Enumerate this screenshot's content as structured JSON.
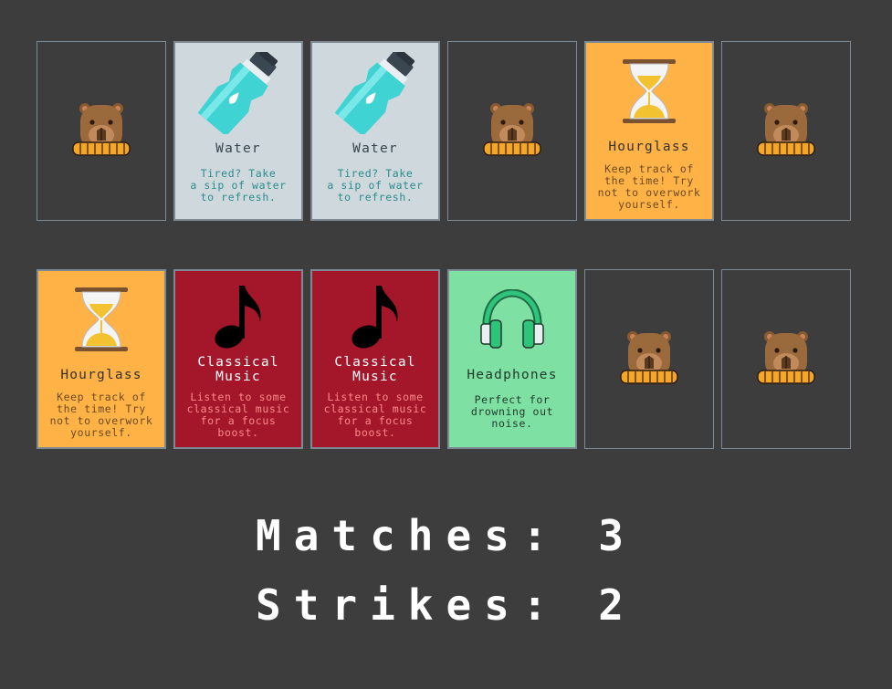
{
  "game": {
    "cards": [
      {
        "state": "facedown",
        "icon": "capybara-icon"
      },
      {
        "state": "faceup",
        "theme": "water",
        "icon": "water-bottle-icon",
        "title": "Water",
        "desc": [
          "Tired? Take",
          "a sip of water",
          "to refresh."
        ]
      },
      {
        "state": "faceup",
        "theme": "water",
        "icon": "water-bottle-icon",
        "title": "Water",
        "desc": [
          "Tired? Take",
          "a sip of water",
          "to refresh."
        ]
      },
      {
        "state": "facedown",
        "icon": "capybara-icon"
      },
      {
        "state": "faceup",
        "theme": "hourglass",
        "icon": "hourglass-icon",
        "title": "Hourglass",
        "desc": [
          "Keep track of",
          "the time! Try",
          "not to overwork",
          "yourself."
        ]
      },
      {
        "state": "facedown",
        "icon": "capybara-icon"
      },
      {
        "state": "faceup",
        "theme": "hourglass",
        "icon": "hourglass-icon",
        "title": "Hourglass",
        "desc": [
          "Keep track of",
          "the time! Try",
          "not to overwork",
          "yourself."
        ]
      },
      {
        "state": "faceup",
        "theme": "music",
        "icon": "music-note-icon",
        "title": [
          "Classical",
          "Music"
        ],
        "desc": [
          "Listen to some",
          "classical music",
          "for a focus",
          "boost."
        ]
      },
      {
        "state": "faceup",
        "theme": "music",
        "icon": "music-note-icon",
        "title": [
          "Classical",
          "Music"
        ],
        "desc": [
          "Listen to some",
          "classical music",
          "for a focus",
          "boost."
        ]
      },
      {
        "state": "faceup",
        "theme": "headphones",
        "icon": "headphones-icon",
        "title": "Headphones",
        "desc": [
          "Perfect for",
          "drowning out",
          "noise."
        ]
      },
      {
        "state": "facedown",
        "icon": "capybara-icon"
      },
      {
        "state": "facedown",
        "icon": "capybara-icon"
      }
    ]
  },
  "score": {
    "matches_label": "Matches:",
    "matches_value": "3",
    "strikes_label": "Strikes:",
    "strikes_value": "2"
  },
  "colors": {
    "background": "#3d3d3d",
    "water": "#cfd8dd",
    "hourglass": "#ffb347",
    "music": "#a4162a",
    "headphones": "#7fe0a3"
  }
}
